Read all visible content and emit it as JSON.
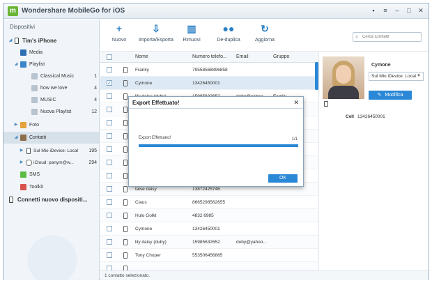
{
  "window": {
    "title": "Wondershare MobileGo for iOS",
    "logo_letter": "m"
  },
  "sidebar": {
    "header": "Dispositivi",
    "device_name": "Tim's iPhone",
    "items": [
      {
        "label": "Media",
        "count": ""
      },
      {
        "label": "Playlist",
        "count": ""
      },
      {
        "label": "Classical Music",
        "count": "1"
      },
      {
        "label": "how we love",
        "count": "4"
      },
      {
        "label": "MUSIC",
        "count": "4"
      },
      {
        "label": "Nuova Playlist",
        "count": "12"
      },
      {
        "label": "Foto",
        "count": ""
      },
      {
        "label": "Contatti",
        "count": ""
      },
      {
        "label": "Sul Mio iDevice: Local",
        "count": "195"
      },
      {
        "label": "iCloud: panym@w...",
        "count": "294"
      },
      {
        "label": "SMS",
        "count": ""
      },
      {
        "label": "Toolkit",
        "count": ""
      }
    ],
    "connect_label": "Connetti nuovo dispositi..."
  },
  "toolbar": {
    "buttons": [
      {
        "label": "Nuovo",
        "icon": "plus-icon"
      },
      {
        "label": "Importa/Esporta",
        "icon": "import-export-icon"
      },
      {
        "label": "Rimuovi",
        "icon": "trash-icon"
      },
      {
        "label": "De-duplica",
        "icon": "people-icon"
      },
      {
        "label": "Aggiorna",
        "icon": "refresh-icon"
      }
    ],
    "search_placeholder": "Cerca Contatti"
  },
  "table": {
    "columns": [
      "Nome",
      "Numero telefo...",
      "Email",
      "Gruppo"
    ],
    "rows": [
      {
        "name": "Franky",
        "phone": "79558568896858",
        "email": "",
        "group": "",
        "checked": false
      },
      {
        "name": "Cymone",
        "phone": "13426450001",
        "email": "",
        "group": "",
        "checked": true
      },
      {
        "name": "lily daisy (duby)",
        "phone": "15985632652",
        "email": "duby@yahoo...",
        "group": "Family",
        "checked": false
      },
      {
        "name": "",
        "phone": "",
        "email": "",
        "group": "",
        "checked": false
      },
      {
        "name": "",
        "phone": "",
        "email": "",
        "group": "",
        "checked": false
      },
      {
        "name": "",
        "phone": "",
        "email": "",
        "group": "",
        "checked": false
      },
      {
        "name": "",
        "phone": "",
        "email": "",
        "group": "",
        "checked": false
      },
      {
        "name": "",
        "phone": "",
        "email": "",
        "group": "",
        "checked": false
      },
      {
        "name": "",
        "phone": "",
        "email": "",
        "group": "",
        "checked": false
      },
      {
        "name": "taise daisy",
        "phone": "13872425746",
        "email": "",
        "group": "",
        "checked": false
      },
      {
        "name": "Claus",
        "phone": "8665298562655",
        "email": "",
        "group": "",
        "checked": false
      },
      {
        "name": "Hulo Golkt",
        "phone": "4832 6985",
        "email": "",
        "group": "",
        "checked": false
      },
      {
        "name": "Cymone",
        "phone": "13426450001",
        "email": "",
        "group": "",
        "checked": false
      },
      {
        "name": "lily daisy (duby)",
        "phone": "15985632652",
        "email": "duby@yahoo...",
        "group": "",
        "checked": false
      },
      {
        "name": "Tony Choper",
        "phone": "553506456885",
        "email": "",
        "group": "",
        "checked": false
      },
      {
        "name": "",
        "phone": "",
        "email": "",
        "group": "",
        "checked": false
      }
    ]
  },
  "detail": {
    "name": "Cymone",
    "location": "Sul Mio iDevice: Local",
    "edit_label": "Modifica",
    "cell_label": "Cell",
    "cell_value": "13426450001"
  },
  "status": {
    "text": "1 contatto selezionato."
  },
  "dialog": {
    "title": "Export Effettuato!",
    "message": "Export Effettuato!",
    "count": "1/1",
    "progress": 1.0,
    "ok_label": "OK"
  },
  "colors": {
    "accent": "#2a88d6",
    "logo": "#6ab536"
  }
}
